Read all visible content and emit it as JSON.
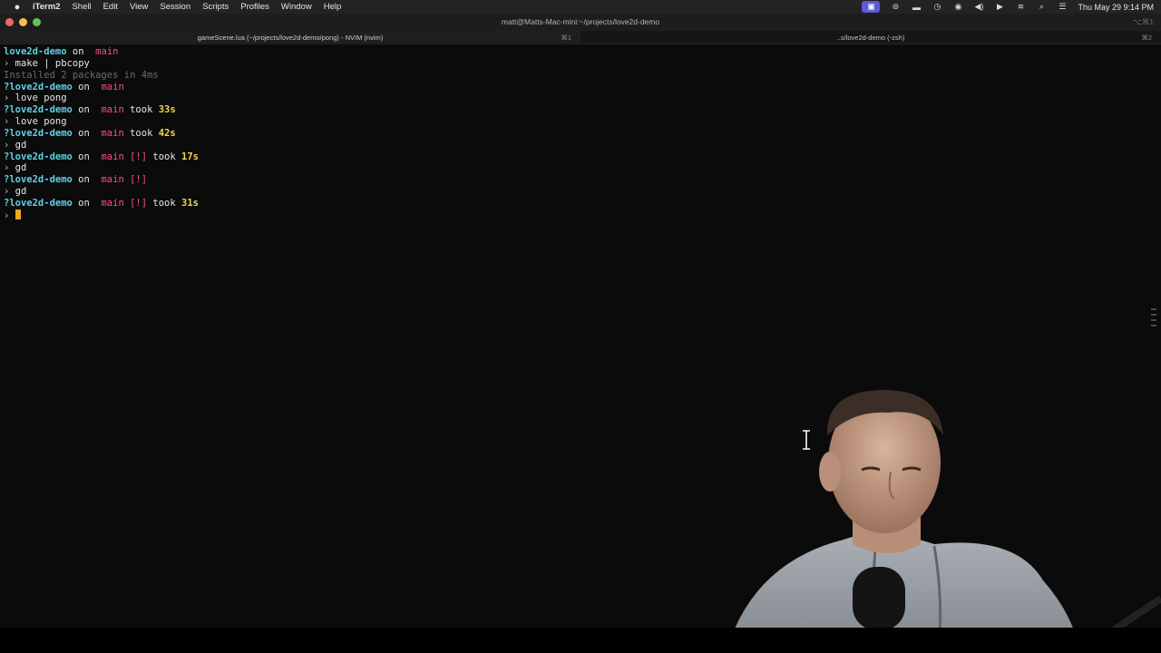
{
  "menubar": {
    "app_name": "iTerm2",
    "items": [
      "Shell",
      "Edit",
      "View",
      "Session",
      "Scripts",
      "Profiles",
      "Window",
      "Help"
    ],
    "clock": "Thu May 29  9:14 PM"
  },
  "window": {
    "title": "matt@Matts-Mac-mini:~/projects/love2d-demo",
    "shortcut": "⌥⌘1"
  },
  "tabs": [
    {
      "label": "gameScene.lua (~/projects/love2d-demo/pong) - NVIM (nvim)",
      "key": "⌘1"
    },
    {
      "label": "..s/love2d-demo (-zsh)",
      "key": "⌘2"
    }
  ],
  "terminal": {
    "dir": "love2d-demo",
    "on": "on",
    "branch_icon": "",
    "branch": "main",
    "prompt_char": "›",
    "lines": [
      {
        "type": "prompt",
        "dir_prefix": "",
        "status": "",
        "took": ""
      },
      {
        "type": "cmd",
        "text": "make | pbcopy"
      },
      {
        "type": "out",
        "text": "Installed 2 packages in 4ms"
      },
      {
        "type": "prompt",
        "dir_prefix": "?",
        "status": "",
        "took": ""
      },
      {
        "type": "cmd",
        "text": "love pong"
      },
      {
        "type": "prompt",
        "dir_prefix": "?",
        "status": "",
        "took": "33s"
      },
      {
        "type": "cmd",
        "text": "love pong"
      },
      {
        "type": "prompt",
        "dir_prefix": "?",
        "status": "",
        "took": "42s"
      },
      {
        "type": "cmd",
        "text": "gd"
      },
      {
        "type": "prompt",
        "dir_prefix": "?",
        "status": "[!]",
        "took": "17s"
      },
      {
        "type": "cmd",
        "text": "gd"
      },
      {
        "type": "prompt",
        "dir_prefix": "?",
        "status": "[!]",
        "took": ""
      },
      {
        "type": "cmd",
        "text": "gd"
      },
      {
        "type": "prompt",
        "dir_prefix": "?",
        "status": "[!]",
        "took": "31s"
      },
      {
        "type": "input",
        "text": ""
      }
    ],
    "took_word": "took"
  },
  "colors": {
    "dir": "#5ed0e6",
    "branch": "#ff4f7a",
    "duration": "#f2d64b",
    "cursor": "#f5a623"
  }
}
